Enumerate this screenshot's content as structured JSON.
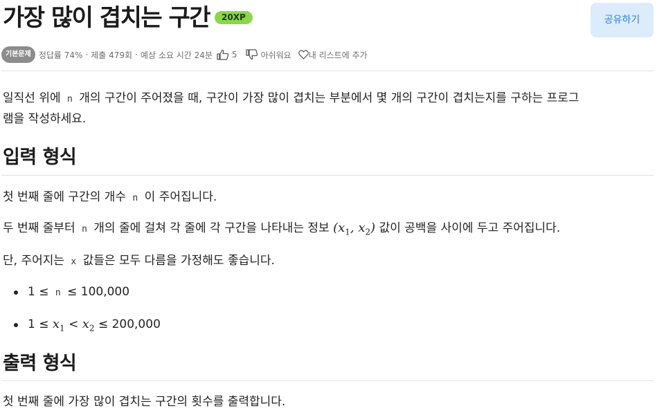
{
  "problem": {
    "title": "가장 많이 겹치는 구간",
    "xp": "20XP",
    "share_label": "공유하기"
  },
  "meta": {
    "level": "기본문제",
    "accuracy": "정답률 74%",
    "submissions": "제출 479회",
    "time": "예상 소요 시간 24분",
    "likes": "5",
    "dislike_label": "아쉬워요",
    "add_list_label": "내 리스트에 추가"
  },
  "statement": {
    "intro_a": "일직선 위에",
    "intro_var": "n",
    "intro_b": "개의 구간이 주어졌을 때, 구간이 가장 많이 겹치는 부분에서 몇 개의 구간이 겹치는지를 구하는 프로그",
    "intro_c": "램을 작성하세요."
  },
  "input_section": {
    "heading": "입력 형식",
    "line1_a": "첫 번째 줄에 구간의 개수",
    "line1_var": "n",
    "line1_b": "이 주어집니다.",
    "line2_a": "두 번째 줄부터",
    "line2_var": "n",
    "line2_b": "개의 줄에 걸쳐 각 줄에 각 구간을 나타내는 정보",
    "line2_math": "(x",
    "line2_sub1": "1",
    "line2_comma": ", x",
    "line2_sub2": "2",
    "line2_close": ")",
    "line2_c": "값이 공백을 사이에 두고 주어집니다.",
    "line3_a": "단, 주어지는",
    "line3_var": "x",
    "line3_b": "값들은 모두 다름을 가정해도 좋습니다.",
    "constraint1_a": "1 ≤",
    "constraint1_var": "n",
    "constraint1_b": "≤ 100,000",
    "constraint2_a": "1 ≤",
    "constraint2_x1": "x",
    "constraint2_s1": "1",
    "constraint2_lt": "<",
    "constraint2_x2": "x",
    "constraint2_s2": "2",
    "constraint2_b": "≤ 200,000"
  },
  "output_section": {
    "heading": "출력 형식",
    "line1": "첫 번째 줄에 가장 많이 겹치는 구간의 횟수를 출력합니다."
  }
}
